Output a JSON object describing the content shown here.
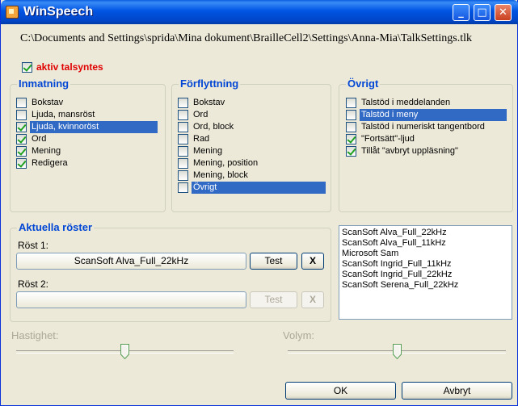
{
  "window": {
    "title": "WinSpeech"
  },
  "path": "C:\\Documents and Settings\\sprida\\Mina dokument\\BrailleCell2\\Settings\\Anna-Mia\\TalkSettings.tlk",
  "aktiv": {
    "label": "aktiv talsyntes",
    "checked": true
  },
  "inmatning": {
    "title": "Inmatning",
    "items": [
      {
        "label": "Bokstav",
        "checked": false
      },
      {
        "label": "Ljuda, mansröst",
        "checked": false
      },
      {
        "label": "Ljuda, kvinnoröst",
        "checked": true
      },
      {
        "label": "Ord",
        "checked": true
      },
      {
        "label": "Mening",
        "checked": true
      },
      {
        "label": "Redigera",
        "checked": true
      }
    ]
  },
  "forflyttning": {
    "title": "Förflyttning",
    "items": [
      {
        "label": "Bokstav",
        "checked": false
      },
      {
        "label": "Ord",
        "checked": false
      },
      {
        "label": "Ord, block",
        "checked": false
      },
      {
        "label": "Rad",
        "checked": false
      },
      {
        "label": "Mening",
        "checked": false
      },
      {
        "label": "Mening, position",
        "checked": false
      },
      {
        "label": "Mening, block",
        "checked": false
      },
      {
        "label": "Övrigt",
        "checked": false
      }
    ]
  },
  "ovrigt": {
    "title": "Övrigt",
    "items": [
      {
        "label": "Talstöd i meddelanden",
        "checked": false
      },
      {
        "label": "Talstöd i meny",
        "checked": false
      },
      {
        "label": "Talstöd i numeriskt tangentbord",
        "checked": false
      },
      {
        "label": "\"Fortsätt\"-ljud",
        "checked": true
      },
      {
        "label": "Tillåt \"avbryt uppläsning\"",
        "checked": true
      }
    ]
  },
  "voices": {
    "title": "Aktuella röster",
    "voice1_label": "Röst 1:",
    "voice1_value": "ScanSoft Alva_Full_22kHz",
    "voice2_label": "Röst 2:",
    "voice2_value": "",
    "test_label": "Test",
    "remove_label": "X"
  },
  "voice_list": [
    "ScanSoft Alva_Full_22kHz",
    "ScanSoft Alva_Full_11kHz",
    "Microsoft Sam",
    "ScanSoft Ingrid_Full_11kHz",
    "ScanSoft Ingrid_Full_22kHz",
    "ScanSoft Serena_Full_22kHz"
  ],
  "speed": {
    "label": "Hastighet:",
    "level": 0.5
  },
  "volume": {
    "label": "Volym:",
    "level": 0.5
  },
  "buttons": {
    "ok": "OK",
    "cancel": "Avbryt"
  },
  "colors": {
    "selection": "#316ac5",
    "group_title": "#0046d5",
    "aktiv_label": "#e00000"
  }
}
